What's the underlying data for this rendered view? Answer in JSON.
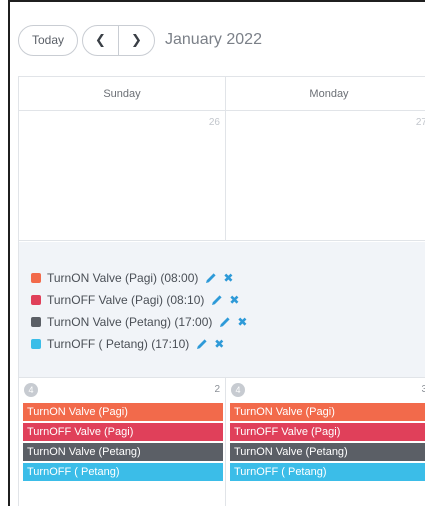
{
  "toolbar": {
    "today_label": "Today",
    "prev_icon": "chevron-left-icon",
    "next_icon": "chevron-right-icon",
    "month_title": "January 2022"
  },
  "calendar": {
    "weekdays": [
      "Sunday",
      "Monday"
    ],
    "week1_days": [
      "26",
      "27"
    ],
    "week2_days": [
      "2",
      "3"
    ],
    "week2_badges": [
      "4",
      "4"
    ]
  },
  "legend": [
    {
      "label": "TurnON Valve (Pagi) (08:00)",
      "color": "#f26a4b"
    },
    {
      "label": "TurnOFF Valve (Pagi) (08:10)",
      "color": "#e0405a"
    },
    {
      "label": "TurnON Valve (Petang) (17:00)",
      "color": "#5b5f66"
    },
    {
      "label": "TurnOFF ( Petang) (17:10)",
      "color": "#3bbde8"
    }
  ],
  "events": [
    {
      "label": "TurnON Valve (Pagi)",
      "color": "#f26a4b"
    },
    {
      "label": "TurnOFF Valve (Pagi)",
      "color": "#e0405a"
    },
    {
      "label": "TurnON Valve (Petang)",
      "color": "#5b5f66"
    },
    {
      "label": "TurnOFF ( Petang)",
      "color": "#3bbde8"
    }
  ],
  "colors": {
    "accent_icon": "#2e9ad8"
  }
}
